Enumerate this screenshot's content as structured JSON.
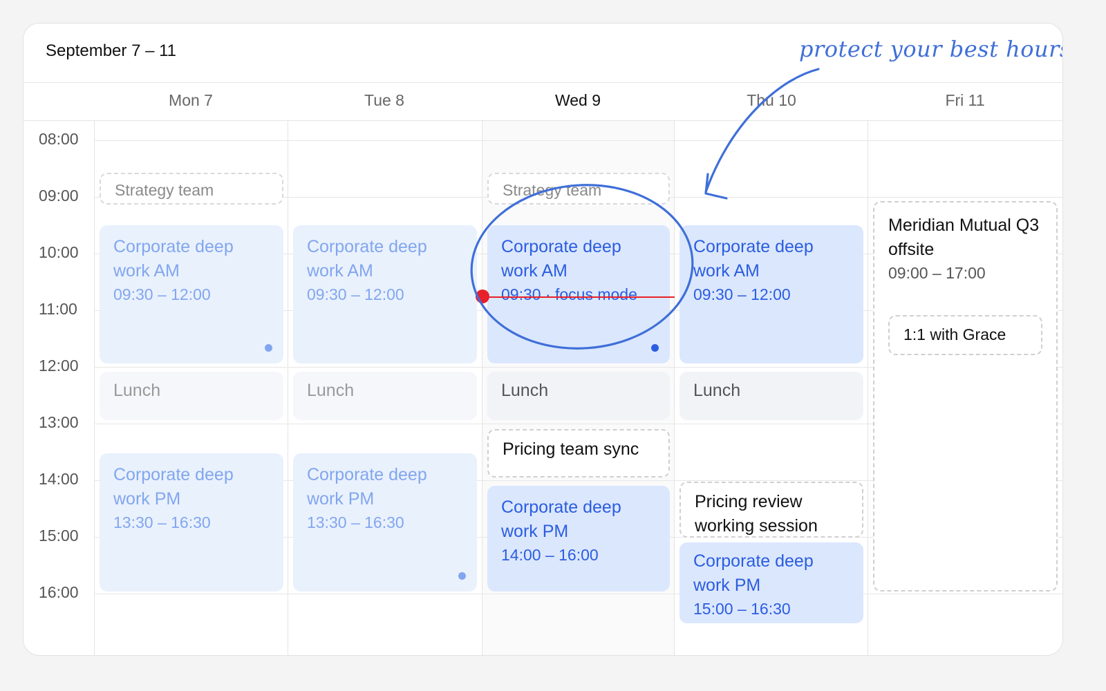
{
  "header": {
    "date_range": "September 7 – 11",
    "annotation": "protect your best hours"
  },
  "days": [
    {
      "label": "Mon 7",
      "today": false
    },
    {
      "label": "Tue 8",
      "today": false
    },
    {
      "label": "Wed 9",
      "today": true
    },
    {
      "label": "Thu 10",
      "today": false
    },
    {
      "label": "Fri 11",
      "today": false
    }
  ],
  "hours": [
    "08:00",
    "09:00",
    "10:00",
    "11:00",
    "12:00",
    "13:00",
    "14:00",
    "15:00",
    "16:00"
  ],
  "events": {
    "mon_strategy": {
      "title": "Strategy team"
    },
    "mon_deep_am": {
      "title": "Corporate deep work AM",
      "time": "09:30 – 12:00"
    },
    "mon_lunch": {
      "title": "Lunch"
    },
    "mon_deep_pm": {
      "title": "Corporate deep work PM",
      "time": "13:30 – 16:30"
    },
    "tue_deep_am": {
      "title": "Corporate deep work AM",
      "time": "09:30 – 12:00"
    },
    "tue_lunch": {
      "title": "Lunch"
    },
    "tue_deep_pm": {
      "title": "Corporate deep work PM",
      "time": "13:30 – 16:30"
    },
    "wed_strategy": {
      "title": "Strategy team"
    },
    "wed_deep_am": {
      "title": "Corporate deep work AM",
      "time": "09:30 · focus mode"
    },
    "wed_lunch": {
      "title": "Lunch"
    },
    "wed_pricing_sync": {
      "title": "Pricing team sync"
    },
    "wed_deep_pm": {
      "title": "Corporate deep work PM",
      "time": "14:00 – 16:00"
    },
    "thu_deep_am": {
      "title": "Corporate deep work AM",
      "time": "09:30 – 12:00"
    },
    "thu_lunch": {
      "title": "Lunch"
    },
    "thu_pricing_review": {
      "title": "Pricing review working session"
    },
    "thu_deep_pm": {
      "title": "Corporate deep work PM",
      "time": "15:00 – 16:30"
    },
    "fri_offsite": {
      "title": "Meridian Mutual Q3 offsite",
      "time": "09:00 – 17:00"
    },
    "fri_one_on_one": {
      "title": "1:1 with Grace"
    }
  },
  "colors": {
    "accent": "#2b5de0",
    "annotation": "#3f6fd8",
    "now_indicator": "#e8202a"
  }
}
